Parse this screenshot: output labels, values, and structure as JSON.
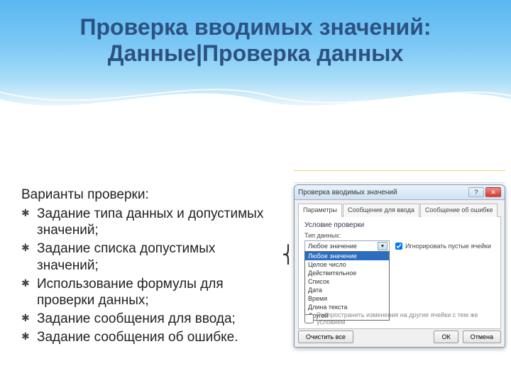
{
  "title_line1": "Проверка вводимых значений:",
  "title_line2": "Данные|Проверка данных",
  "intro": "Варианты проверки:",
  "bullets": [
    "Задание типа данных и допустимых значений;",
    "Задание списка допустимых значений;",
    "Использование формулы для проверки данных;",
    "Задание сообщения для ввода;",
    "Задание сообщения об ошибке."
  ],
  "dialog": {
    "title": "Проверка вводимых значений",
    "help": "?",
    "close": "✕",
    "tabs": [
      "Параметры",
      "Сообщение для ввода",
      "Сообщение об ошибке"
    ],
    "group": "Условие проверки",
    "type_label": "Тип данных:",
    "type_value": "Любое значение",
    "ignore_blank": "Игнорировать пустые ячейки",
    "options": [
      "Любое значение",
      "Целое число",
      "Действительное",
      "Список",
      "Дата",
      "Время",
      "Длина текста",
      "Другой"
    ],
    "selected_option": "Любое значение",
    "spread": "Распространить изменения на другие ячейки с тем же условием",
    "clear": "Очистить все",
    "ok": "ОК",
    "cancel": "Отмена"
  }
}
